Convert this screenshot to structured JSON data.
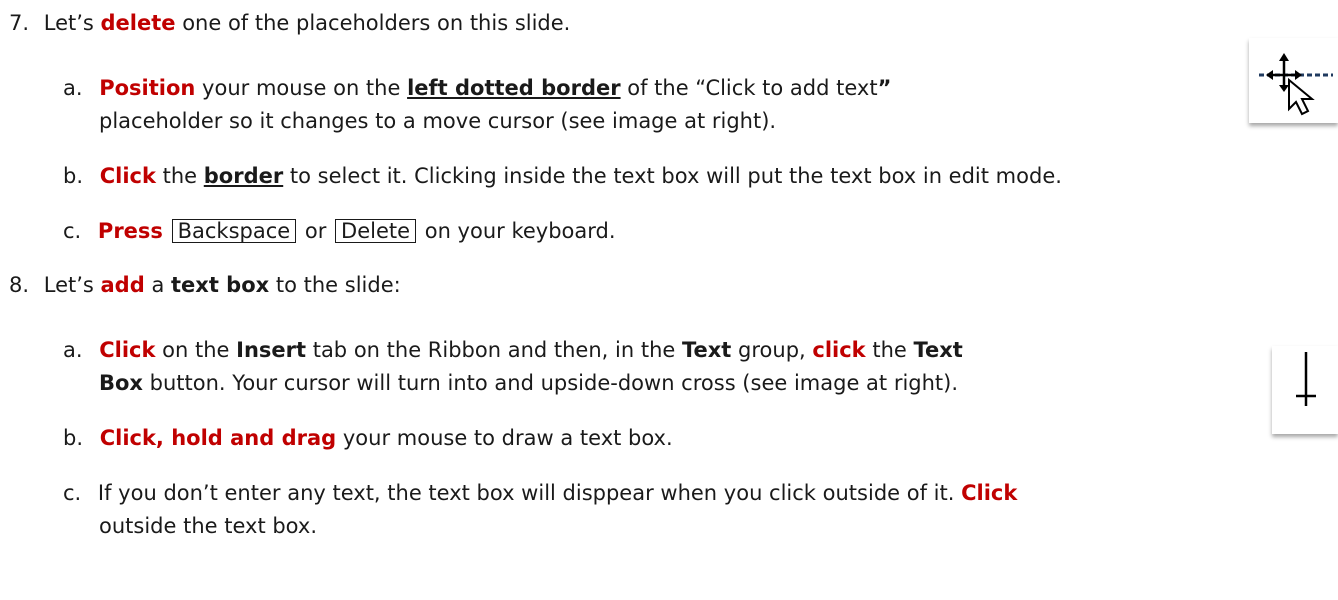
{
  "step7": {
    "num": "7.",
    "t1": "Let’s ",
    "k1": "delete",
    "t2": " one of the placeholders on this slide.",
    "a": {
      "label": "a.",
      "k1": "Position",
      "t1": " your mouse on the ",
      "u1": "left dotted border",
      "t2": " of the “Click to add text",
      "q": "”",
      "line2": "placeholder so it changes to a move cursor (see image at right)."
    },
    "b": {
      "label": "b.",
      "k1": "Click",
      "t1": " the ",
      "u1": "border",
      "t2": " to select it.  Clicking inside the text box will put the text box in edit mode."
    },
    "c": {
      "label": "c.",
      "k1": "Press",
      "key1": "Backspace",
      "t1": " or ",
      "key2": "Delete",
      "t2": " on your keyboard."
    }
  },
  "step8": {
    "num": "8.",
    "t1": "Let’s ",
    "k1": "add",
    "t2": " a ",
    "b1": "text box",
    "t3": " to the slide:",
    "a": {
      "label": "a.",
      "k1": "Click",
      "t1": " on the ",
      "b1": "Insert",
      "t2": " tab on the Ribbon and then, in the ",
      "b2": "Text",
      "t3": " group, ",
      "k2": "click",
      "t4": " the ",
      "b3": "Text",
      "b4": "Box",
      "t5": " button. Your cursor will turn into and upside-down cross (see image at right)."
    },
    "b": {
      "label": "b.",
      "k1": "Click, hold and drag",
      "t1": " your mouse to draw a text box."
    },
    "c": {
      "label": "c.",
      "t1": "If you don’t enter any text, the text box will disppear when you click outside of it.  ",
      "k1": "Click",
      "line2": "outside the text box."
    }
  },
  "icons": {
    "move_cursor": "move-cursor-icon",
    "text_cursor": "text-box-cursor-icon"
  },
  "colors": {
    "keyword": "#c00000",
    "text": "#1a1a1a"
  }
}
